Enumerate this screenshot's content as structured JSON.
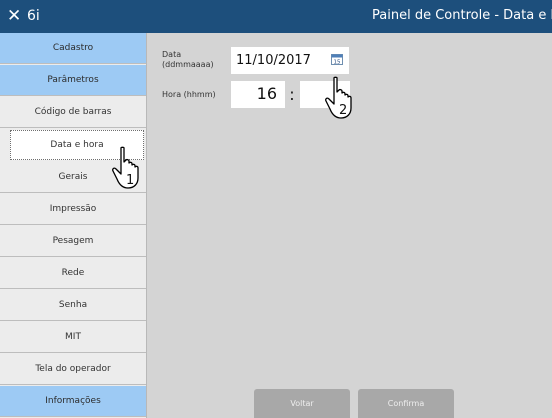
{
  "titlebar": {
    "close_glyph": "✕",
    "app_name": "6i",
    "title": "Painel de Controle - Data e hora",
    "color": "#1d4f7c"
  },
  "sidebar": {
    "header_color": "#9dcaf4",
    "items": [
      {
        "label": "Cadastro",
        "style": "header"
      },
      {
        "label": "Parâmetros",
        "style": "header"
      },
      {
        "label": "Código de barras",
        "style": "normal"
      },
      {
        "label": "Data e hora",
        "style": "active"
      },
      {
        "label": "Gerais",
        "style": "normal"
      },
      {
        "label": "Impressão",
        "style": "normal"
      },
      {
        "label": "Pesagem",
        "style": "normal"
      },
      {
        "label": "Rede",
        "style": "normal"
      },
      {
        "label": "Senha",
        "style": "normal"
      },
      {
        "label": "MIT",
        "style": "normal"
      },
      {
        "label": "Tela do operador",
        "style": "normal"
      },
      {
        "label": "Informações",
        "style": "header"
      }
    ]
  },
  "form": {
    "date_label_line1": "Data",
    "date_label_line2": "(ddmmaaaa)",
    "date_value": "11/10/2017",
    "calendar_icon": "calendar-icon",
    "calendar_day": "15",
    "hour_label": "Hora (hhmm)",
    "hour_value": "16",
    "separator": ":",
    "minute_value": ""
  },
  "buttons": {
    "back_label": "Voltar",
    "confirm_label": "Confirma"
  },
  "annotations": {
    "step1": "1",
    "step2": "2"
  }
}
